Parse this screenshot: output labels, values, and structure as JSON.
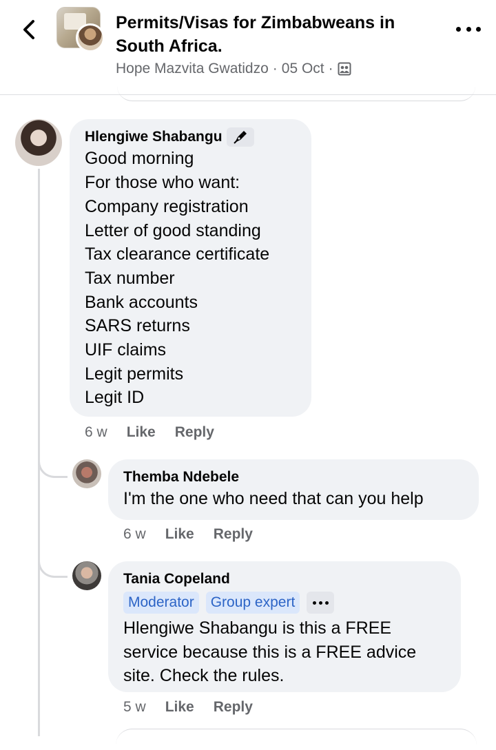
{
  "header": {
    "title_line1": "Permits/Visas for Zimbabweans in",
    "title_line2": "South Africa.",
    "author": "Hope Mazvita Gwatidzo",
    "date": "05 Oct",
    "separator": "·",
    "audience_icon": "group-icon"
  },
  "comments": [
    {
      "author": "Hlengiwe Shabangu",
      "author_badge_icon": "pen-nib-icon",
      "lines": [
        "Good morning",
        "For those who want:",
        "Company registration",
        "Letter of good standing",
        "Tax clearance certificate",
        "Tax number",
        "Bank accounts",
        "SARS returns",
        "UIF claims",
        "Legit permits",
        "Legit ID"
      ],
      "time": "6 w",
      "like_label": "Like",
      "reply_label": "Reply"
    },
    {
      "author": "Themba Ndebele",
      "text": "I'm the one who need that can you help",
      "time": "6 w",
      "like_label": "Like",
      "reply_label": "Reply"
    },
    {
      "author": "Tania Copeland",
      "badges": [
        "Moderator",
        "Group expert"
      ],
      "text_line1": "Hlengiwe Shabangu is this a FREE",
      "text_line2": "service because this is a FREE advice",
      "text_line3": "site. Check the rules.",
      "time": "5 w",
      "like_label": "Like",
      "reply_label": "Reply"
    }
  ],
  "colors": {
    "bubble": "#f0f2f5",
    "secondary_text": "#65676b",
    "badge_bg": "#dbe7fb",
    "badge_text": "#2c64c6"
  }
}
